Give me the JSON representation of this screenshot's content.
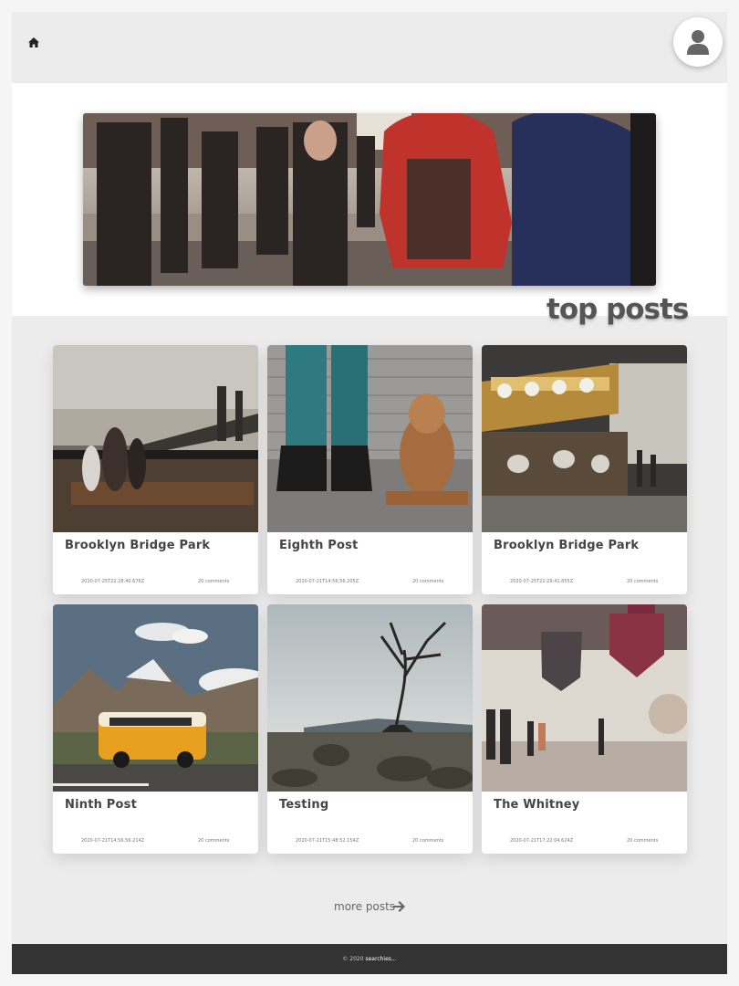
{
  "header": {
    "home_icon": "home-icon",
    "avatar_icon": "user-icon"
  },
  "hero": {
    "image": "city street crowd with costumed characters"
  },
  "section_title": "top posts",
  "posts": [
    {
      "title": "Brooklyn Bridge Park",
      "date": "2020-07-25T22:28:40.676Z",
      "comments": "20 comments"
    },
    {
      "title": "Eighth Post",
      "date": "2020-07-21T14:56:56.205Z",
      "comments": "20 comments"
    },
    {
      "title": "Brooklyn Bridge Park",
      "date": "2020-07-25T22:29:41.855Z",
      "comments": "20 comments"
    },
    {
      "title": "Ninth Post",
      "date": "2020-07-21T14:56:56.214Z",
      "comments": "20 comments"
    },
    {
      "title": "Testing",
      "date": "2020-07-21T15:48:52.154Z",
      "comments": "20 comments"
    },
    {
      "title": "The Whitney",
      "date": "2020-07-21T17:22:04.624Z",
      "comments": "20 comments"
    }
  ],
  "more_posts": "more posts",
  "footer": {
    "copyright": "© 2020",
    "brand": "searchies..."
  }
}
